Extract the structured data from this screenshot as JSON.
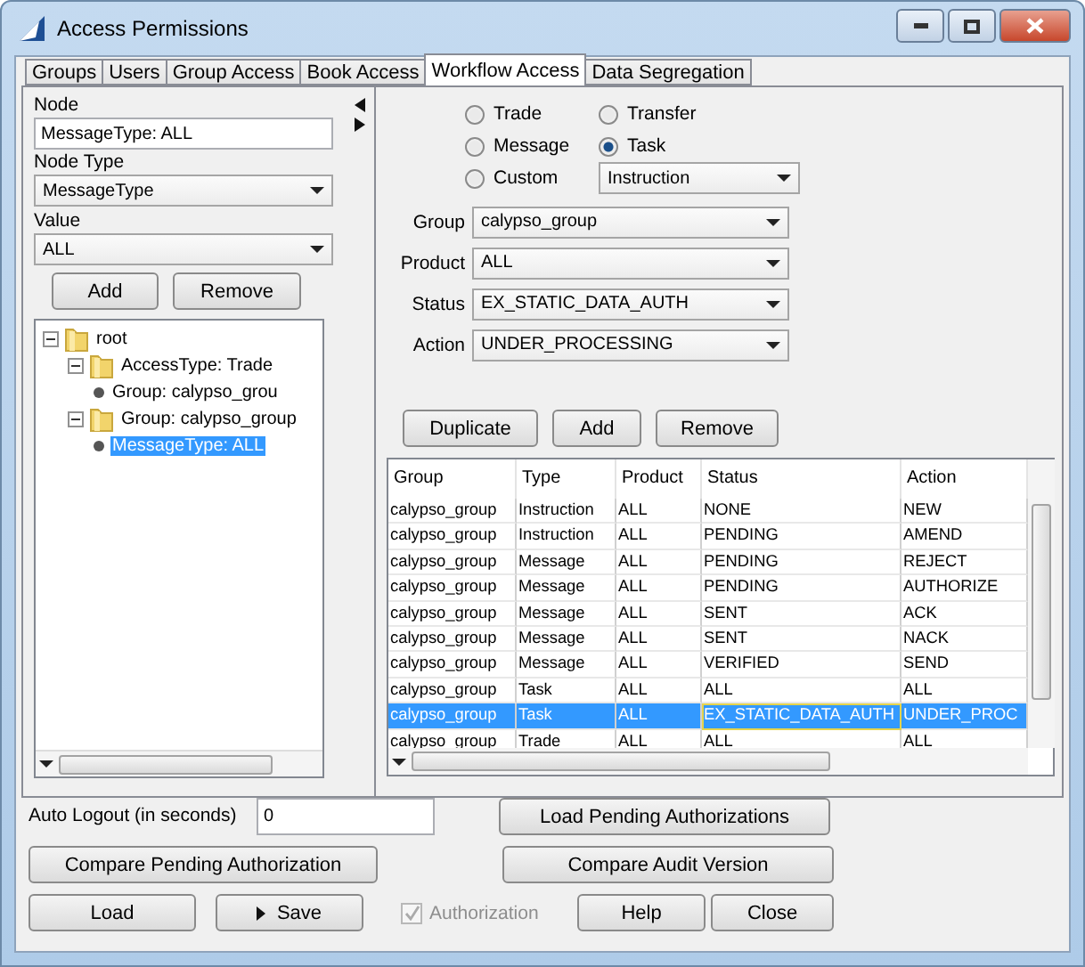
{
  "window": {
    "title": "Access Permissions"
  },
  "tabs": [
    {
      "label": "Groups",
      "selected": false
    },
    {
      "label": "Users",
      "selected": false
    },
    {
      "label": "Group Access",
      "selected": false
    },
    {
      "label": "Book Access",
      "selected": false
    },
    {
      "label": "Workflow Access",
      "selected": true
    },
    {
      "label": "Data Segregation",
      "selected": false
    }
  ],
  "node_panel": {
    "node_label": "Node",
    "node_value": "MessageType: ALL",
    "node_type_label": "Node Type",
    "node_type_value": "MessageType",
    "value_label": "Value",
    "value_value": "ALL",
    "buttons": [
      "Add",
      "Remove"
    ],
    "tree": [
      {
        "label": "root",
        "kind": "folder",
        "expanded": true,
        "selected": false,
        "children": [
          {
            "label": "AccessType: Trade",
            "kind": "folder",
            "expanded": true,
            "selected": false,
            "children": [
              {
                "label": "Group: calypso_grou",
                "kind": "leaf",
                "selected": false
              }
            ]
          },
          {
            "label": "Group: calypso_group",
            "kind": "folder",
            "expanded": true,
            "selected": false,
            "children": [
              {
                "label": "MessageType: ALL",
                "kind": "leaf",
                "selected": true
              }
            ]
          }
        ]
      }
    ]
  },
  "object_types": [
    {
      "label": "Trade",
      "selected": false
    },
    {
      "label": "Transfer",
      "selected": false
    },
    {
      "label": "Message",
      "selected": false
    },
    {
      "label": "Task",
      "selected": true
    },
    {
      "label": "Custom",
      "selected": false
    }
  ],
  "custom_type": "Instruction",
  "filters": [
    {
      "label": "Group",
      "value": "calypso_group"
    },
    {
      "label": "Product",
      "value": "ALL"
    },
    {
      "label": "Status",
      "value": "EX_STATIC_DATA_AUTH"
    },
    {
      "label": "Action",
      "value": "UNDER_PROCESSING"
    }
  ],
  "table_buttons": [
    "Duplicate",
    "Add",
    "Remove"
  ],
  "table": {
    "columns": [
      "Group",
      "Type",
      "Product",
      "Status",
      "Action"
    ],
    "rows": [
      {
        "cells": [
          "calypso_group",
          "Instruction",
          "ALL",
          "NONE",
          "NEW"
        ],
        "selected": false
      },
      {
        "cells": [
          "calypso_group",
          "Instruction",
          "ALL",
          "PENDING",
          "AMEND"
        ],
        "selected": false
      },
      {
        "cells": [
          "calypso_group",
          "Message",
          "ALL",
          "PENDING",
          "REJECT"
        ],
        "selected": false
      },
      {
        "cells": [
          "calypso_group",
          "Message",
          "ALL",
          "PENDING",
          "AUTHORIZE"
        ],
        "selected": false
      },
      {
        "cells": [
          "calypso_group",
          "Message",
          "ALL",
          "SENT",
          "ACK"
        ],
        "selected": false
      },
      {
        "cells": [
          "calypso_group",
          "Message",
          "ALL",
          "SENT",
          "NACK"
        ],
        "selected": false
      },
      {
        "cells": [
          "calypso_group",
          "Message",
          "ALL",
          "VERIFIED",
          "SEND"
        ],
        "selected": false
      },
      {
        "cells": [
          "calypso_group",
          "Task",
          "ALL",
          "ALL",
          "ALL"
        ],
        "selected": false
      },
      {
        "cells": [
          "calypso_group",
          "Task",
          "ALL",
          "EX_STATIC_DATA_AUTH",
          "UNDER_PROC"
        ],
        "selected": true
      },
      {
        "cells": [
          "calypso_group",
          "Trade",
          "ALL",
          "ALL",
          "ALL"
        ],
        "selected": false
      }
    ]
  },
  "auto_logout": {
    "label": "Auto Logout (in seconds)",
    "value": "0"
  },
  "buttons": {
    "load_pending": "Load Pending Authorizations",
    "compare_pending": "Compare Pending Authorization",
    "compare_audit": "Compare Audit Version",
    "load": "Load",
    "save": "Save",
    "help": "Help",
    "close": "Close"
  },
  "authorization": {
    "label": "Authorization",
    "checked": true,
    "disabled": true
  }
}
